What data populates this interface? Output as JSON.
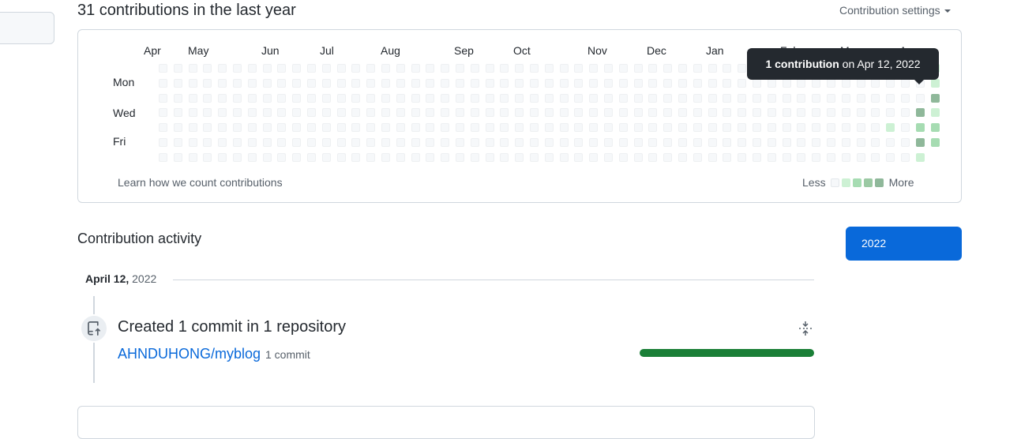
{
  "contributions": {
    "heading": "31 contributions in the last year",
    "settings_label": "Contribution settings",
    "months": [
      "Apr",
      "May",
      "Jun",
      "Jul",
      "Aug",
      "Sep",
      "Oct",
      "Nov",
      "Dec",
      "Jan",
      "Feb",
      "Mar",
      "Apr"
    ],
    "days": [
      "Mon",
      "Wed",
      "Fri"
    ],
    "learn_link": "Learn how we count contributions",
    "legend_less": "Less",
    "legend_more": "More",
    "colors": [
      "#ebedf0",
      "#c6e48b",
      "#9be9a8",
      "#7bc96f",
      "#8fb89a"
    ],
    "tooltip_bold": "1 contribution",
    "tooltip_rest": " on Apr 12, 2022"
  },
  "activity": {
    "title": "Contribution activity",
    "year_button": "2022",
    "date_bold": "April 12,",
    "date_year": " 2022",
    "commit_title": "Created 1 commit in 1 repository",
    "repo": "AHNDUHONG/myblog",
    "repo_commits": "1 commit",
    "progress_fraction": 1.0,
    "progress_color": "#1a7f37"
  }
}
